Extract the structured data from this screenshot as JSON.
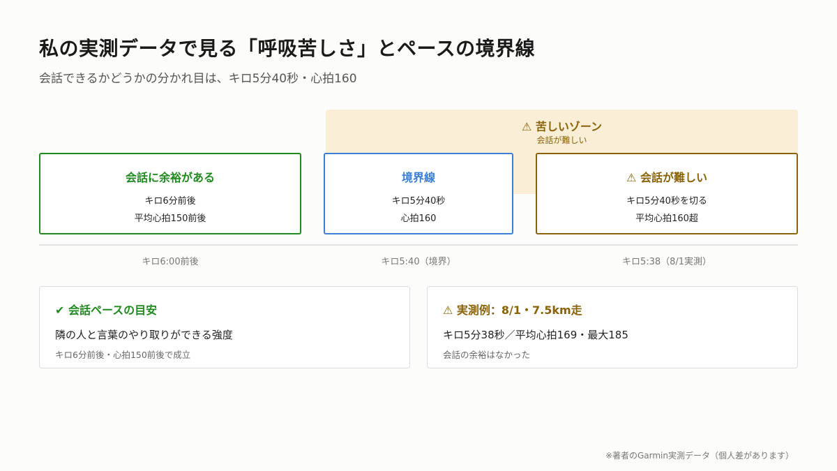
{
  "header": {
    "title": "私の実測データで見る「呼吸苦しさ」とペースの境界線",
    "subtitle": "会話できるかどうかの分かれ目は、キロ5分40秒・心拍160"
  },
  "zone": {
    "title": "⚠ 苦しいゾーン",
    "subtitle": "会話が難しい"
  },
  "stages": [
    {
      "title": "会話に余裕がある",
      "line1": "キロ6分前後",
      "line2": "平均心拍150前後",
      "color": "#1f8a1f"
    },
    {
      "title": "境界線",
      "line1": "キロ5分40秒",
      "line2": "心拍160",
      "color": "#3a7fd4"
    },
    {
      "title": "⚠ 会話が難しい",
      "line1": "キロ5分40秒を切る",
      "line2": "平均心拍160超",
      "color": "#8a6208"
    }
  ],
  "axis_labels": [
    "キロ6:00前後",
    "キロ5:40（境界）",
    "キロ5:38（8/1実測）"
  ],
  "cards": {
    "left": {
      "title": "✔ 会話ペースの目安",
      "main": "隣の人と言葉のやり取りができる強度",
      "note": "キロ6分前後・心拍150前後で成立"
    },
    "right": {
      "title": "⚠ 実測例：8/1・7.5km走",
      "main": "キロ5分38秒／平均心拍169・最大185",
      "note": "会話の余裕はなかった"
    }
  },
  "footnote": "※著者のGarmin実測データ（個人差があります）"
}
